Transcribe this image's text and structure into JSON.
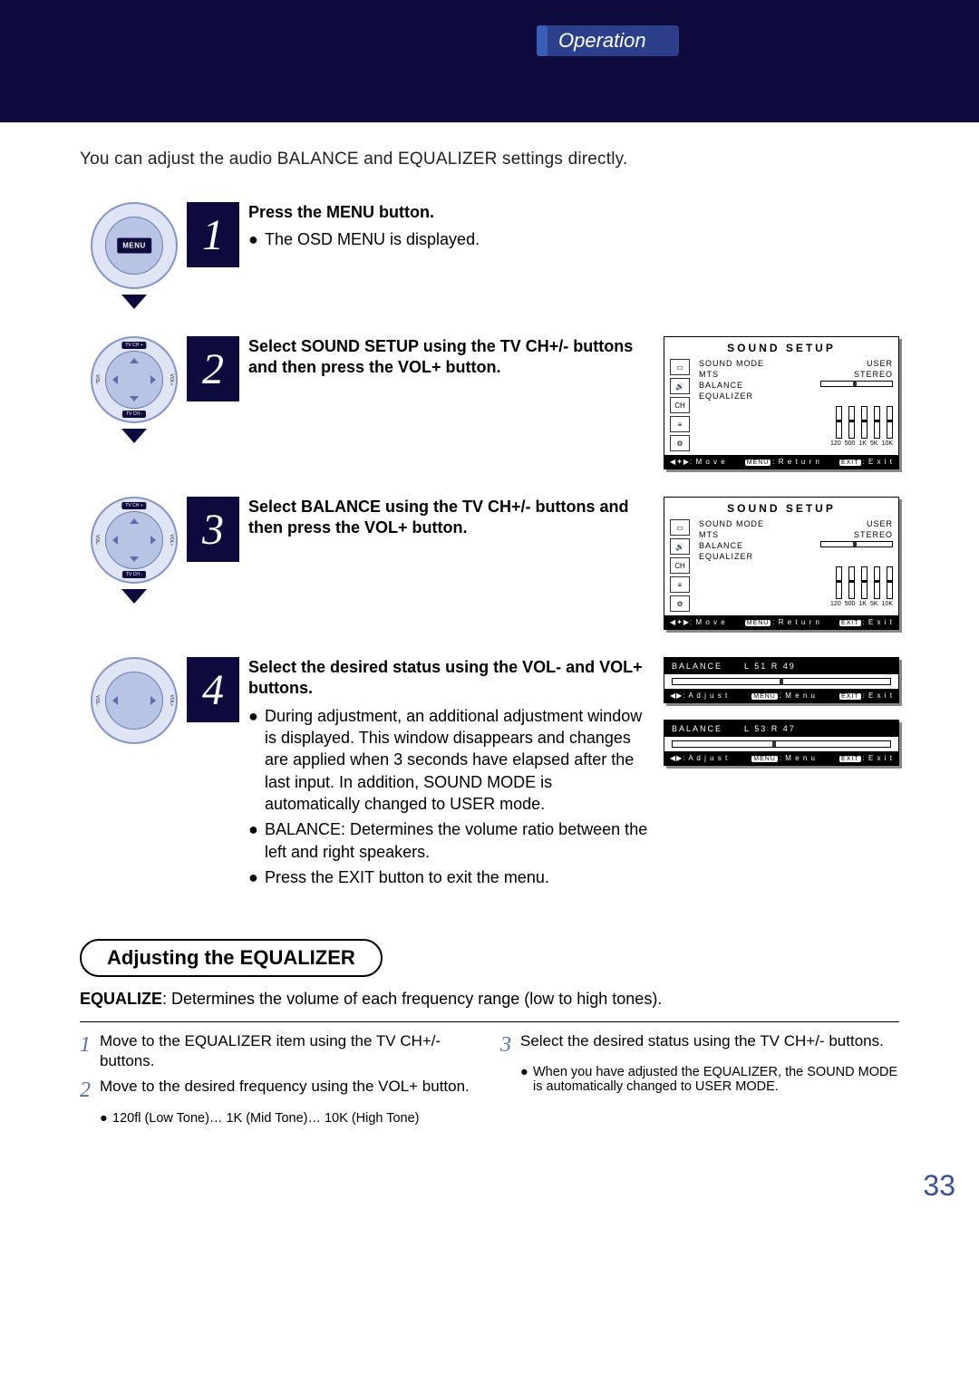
{
  "header": {
    "tab": "Operation"
  },
  "intro": "You can adjust the audio BALANCE and EQUALIZER settings directly.",
  "steps": {
    "s1": {
      "num": "1",
      "title": "Press the MENU button.",
      "b1": "The OSD MENU is displayed.",
      "remote_label": "MENU"
    },
    "s2": {
      "num": "2",
      "title": "Select SOUND SETUP using the TV CH+/- buttons and then press the VOL+ button.",
      "remote": {
        "top": "TV CH +",
        "bottom": "TV CH -",
        "left": "VOL-",
        "right": "VOL+"
      }
    },
    "s3": {
      "num": "3",
      "title": "Select BALANCE using the TV CH+/- buttons and then press the VOL+ button.",
      "remote": {
        "top": "TV CH +",
        "bottom": "TV CH -",
        "left": "VOL-",
        "right": "VOL+"
      }
    },
    "s4": {
      "num": "4",
      "title": "Select the desired status using the VOL- and VOL+ buttons.",
      "b1": "During adjustment, an additional adjustment window is displayed. This window disappears and changes are applied when 3 seconds have elapsed after the last input. In addition, SOUND MODE is automatically changed to USER mode.",
      "b2": "BALANCE: Determines the volume ratio between the left and right speakers.",
      "b3": "Press the EXIT button to exit the menu.",
      "remote": {
        "left": "VOL-",
        "right": "VOL+"
      }
    }
  },
  "osd": {
    "title": "SOUND  SETUP",
    "lines": {
      "sound_mode_k": "SOUND  MODE",
      "sound_mode_v": "USER",
      "mts_k": "MTS",
      "mts_v": "STEREO",
      "balance_k": "BALANCE",
      "equalizer_k": "EQUALIZER"
    },
    "eq_labels": [
      "120",
      "500",
      "1K",
      "5K",
      "10K"
    ],
    "foot": {
      "move": ": M o v e",
      "ret": ": R e t u r n",
      "exit": ": E x i t",
      "menu_tag": "MENU",
      "exit_tag": "EXIT"
    }
  },
  "balance_osd": {
    "a": {
      "label": "BALANCE",
      "val": "L 51  R 49"
    },
    "b": {
      "label": "BALANCE",
      "val": "L 53  R 47"
    },
    "foot": {
      "adj": ": A d j u s t",
      "menu": ": M e n u",
      "exit": ": E x i t",
      "menu_tag": "MENU",
      "exit_tag": "EXIT"
    }
  },
  "equalizer_section": {
    "heading": "Adjusting the EQUALIZER",
    "desc_bold": "EQUALIZE",
    "desc_rest": ": Determines the volume of each frequency range (low to high tones).",
    "left": {
      "i1": {
        "n": "1",
        "t": "Move to the EQUALIZER item using the TV CH+/- buttons."
      },
      "i2": {
        "n": "2",
        "t": "Move to the desired frequency using the VOL+ button.",
        "sub": "120fl (Low Tone)… 1K (Mid Tone)… 10K (High Tone)"
      }
    },
    "right": {
      "i3": {
        "n": "3",
        "t": "Select the desired status using the TV CH+/- buttons.",
        "sub": "When you have adjusted the EQUALIZER, the SOUND MODE is automatically changed to USER MODE."
      }
    }
  },
  "page_number": "33"
}
